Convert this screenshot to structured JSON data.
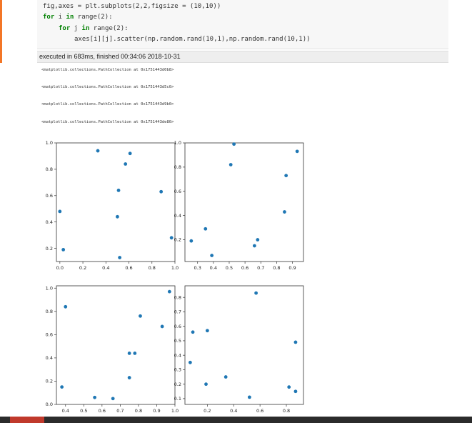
{
  "code": {
    "line1": "fig,axes = plt.subplots(2,2,figsize = (10,10))",
    "line2_kw": "for",
    "line2_rest": " i ",
    "line2_in": "in",
    "line2_range": " range(2):",
    "line3_kw": "for",
    "line3_rest": " j ",
    "line3_in": "in",
    "line3_range": " range(2):",
    "line4": "axes[i][j].scatter(np.random.rand(10,1),np.random.rand(10,1))"
  },
  "exec_status": "executed in 683ms, finished 00:34:06 2018-10-31",
  "outputs": [
    "<matplotlib.collections.PathCollection at 0x1751443d0b8>",
    "<matplotlib.collections.PathCollection at 0x1751443d5c0>",
    "<matplotlib.collections.PathCollection at 0x1751443d9b0>",
    "<matplotlib.collections.PathCollection at 0x1751443de80>"
  ],
  "colors": {
    "point": "#1f77b4",
    "accent": "#f37626"
  },
  "chart_data": [
    {
      "type": "scatter",
      "xlim": [
        -0.03,
        1.0
      ],
      "ylim": [
        0.1,
        1.0
      ],
      "xticks": [
        "0.0",
        "0.2",
        "0.4",
        "0.6",
        "0.8",
        "1.0"
      ],
      "yticks": [
        "0.2",
        "0.4",
        "0.6",
        "0.8",
        "1.0"
      ],
      "xtick_values": [
        0.0,
        0.2,
        0.4,
        0.6,
        0.8,
        1.0
      ],
      "ytick_values": [
        0.2,
        0.4,
        0.6,
        0.8,
        1.0
      ],
      "x": [
        0.33,
        0.61,
        0.57,
        0.51,
        0.88,
        0.5,
        0.97,
        0.52,
        0.0,
        0.03
      ],
      "y": [
        0.94,
        0.92,
        0.84,
        0.64,
        0.63,
        0.44,
        0.28,
        0.13,
        0.48,
        0.19
      ]
    },
    {
      "type": "scatter",
      "xlim": [
        0.22,
        0.97
      ],
      "ylim": [
        0.02,
        1.0
      ],
      "xticks": [
        "0.3",
        "0.4",
        "0.5",
        "0.6",
        "0.7",
        "0.8",
        "0.9"
      ],
      "yticks": [
        "0.2",
        "0.4",
        "0.6",
        "0.8",
        "1.0"
      ],
      "xtick_values": [
        0.3,
        0.4,
        0.5,
        0.6,
        0.7,
        0.8,
        0.9
      ],
      "ytick_values": [
        0.2,
        0.4,
        0.6,
        0.8,
        1.0
      ],
      "x": [
        0.53,
        0.93,
        0.51,
        0.86,
        0.85,
        0.35,
        0.68,
        0.66,
        0.26,
        0.39
      ],
      "y": [
        0.99,
        0.93,
        0.82,
        0.73,
        0.43,
        0.29,
        0.2,
        0.15,
        0.19,
        0.07
      ]
    },
    {
      "type": "scatter",
      "xlim": [
        0.35,
        1.0
      ],
      "ylim": [
        0.0,
        1.02
      ],
      "xticks": [
        "0.4",
        "0.5",
        "0.6",
        "0.7",
        "0.8",
        "0.9",
        "1.0"
      ],
      "yticks": [
        "0.0",
        "0.2",
        "0.4",
        "0.6",
        "0.8",
        "1.0"
      ],
      "xtick_values": [
        0.4,
        0.5,
        0.6,
        0.7,
        0.8,
        0.9,
        1.0
      ],
      "ytick_values": [
        0.0,
        0.2,
        0.4,
        0.6,
        0.8,
        1.0
      ],
      "x": [
        0.97,
        0.4,
        0.81,
        0.93,
        0.75,
        0.78,
        0.75,
        0.38,
        0.56,
        0.66
      ],
      "y": [
        0.97,
        0.84,
        0.76,
        0.67,
        0.44,
        0.44,
        0.23,
        0.15,
        0.06,
        0.05
      ]
    },
    {
      "type": "scatter",
      "xlim": [
        0.03,
        0.93
      ],
      "ylim": [
        0.06,
        0.88
      ],
      "xticks": [
        "0.2",
        "0.4",
        "0.6",
        "0.8"
      ],
      "yticks": [
        "0.1",
        "0.2",
        "0.3",
        "0.4",
        "0.5",
        "0.6",
        "0.7",
        "0.8"
      ],
      "xtick_values": [
        0.2,
        0.4,
        0.6,
        0.8
      ],
      "ytick_values": [
        0.1,
        0.2,
        0.3,
        0.4,
        0.5,
        0.6,
        0.7,
        0.8
      ],
      "x": [
        0.57,
        0.09,
        0.2,
        0.87,
        0.07,
        0.34,
        0.19,
        0.82,
        0.87,
        0.52
      ],
      "y": [
        0.83,
        0.56,
        0.57,
        0.49,
        0.35,
        0.25,
        0.2,
        0.18,
        0.15,
        0.11
      ]
    }
  ]
}
